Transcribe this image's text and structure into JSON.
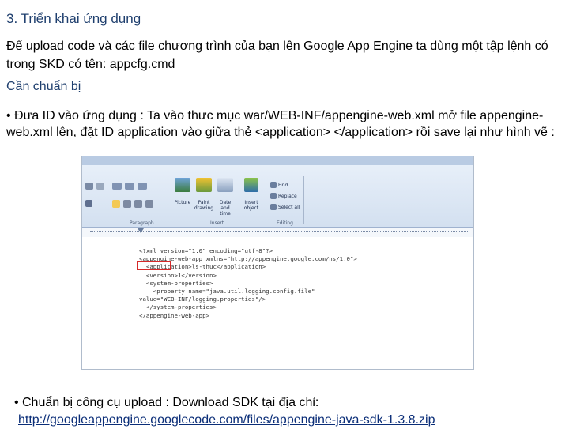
{
  "heading": "3. Triển khai ứng dụng",
  "intro": "Để upload code và các file chương trình của bạn lên Google App Engine ta dùng một tập lệnh có trong SKD có tên: appcfg.cmd",
  "subheading": "Cần chuẩn bị",
  "bullet1": "•  Đưa ID vào ứng dụng : Ta vào  thưc mục war/WEB-INF/appengine-web.xml mở file appengine-web.xml lên, đặt ID application vào giữa thẻ <application> </application> rồi save lại như hình vẽ :",
  "bullet2": {
    "marker": "•",
    "text": "Chuẩn bị công cụ upload : Download SDK tại địa chỉ:",
    "link": "http://googleappengine.googlecode.com/files/appengine-java-sdk-1.3.8.zip"
  },
  "screenshot": {
    "groups": [
      "Paragraph",
      "Insert",
      "Editing"
    ],
    "insert_items": [
      "Picture",
      "Paint drawing",
      "Date and time",
      "Insert object"
    ],
    "editing_items": [
      "Find",
      "Replace",
      "Select all"
    ],
    "xml_lines": [
      "<?xml version=\"1.0\" encoding=\"utf-8\"?>",
      "<appengine-web-app xmlns=\"http://appengine.google.com/ns/1.0\">",
      "  <application>ls-thuc</application>",
      "  <version>1</version>",
      "",
      "  <system-properties>",
      "    <property name=\"java.util.logging.config.file\"",
      "value=\"WEB-INF/logging.properties\"/>",
      "  </system-properties>",
      "</appengine-web-app>"
    ]
  }
}
